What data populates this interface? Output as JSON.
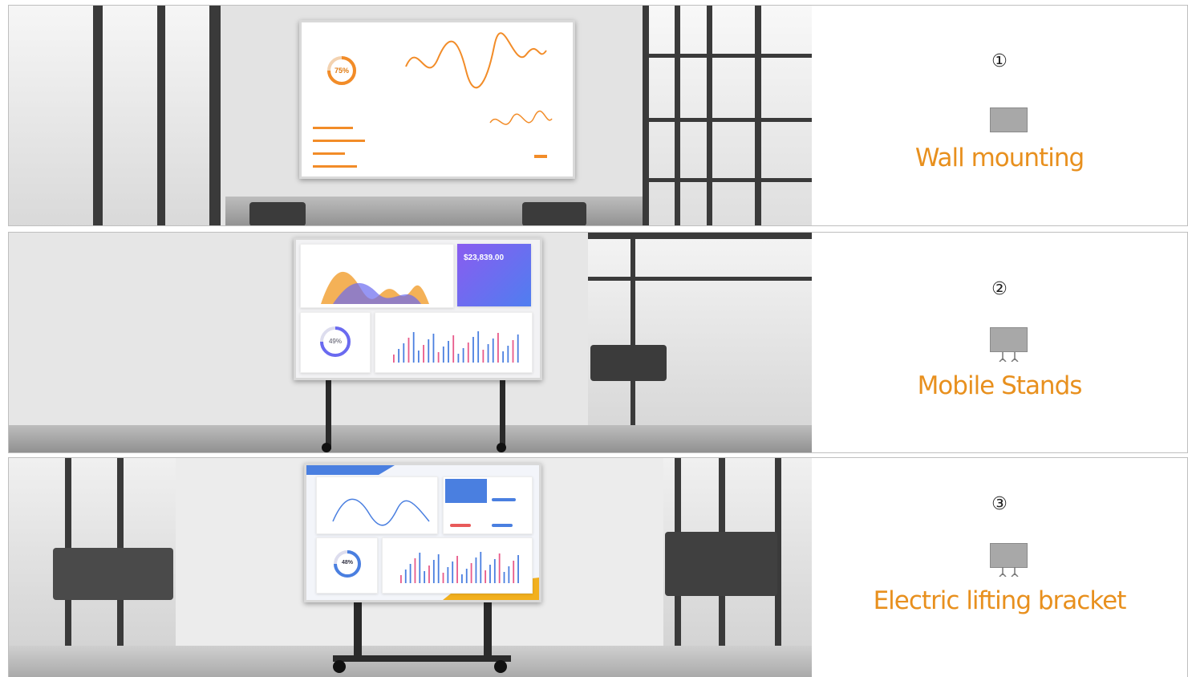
{
  "options": [
    {
      "number": "①",
      "label": "Wall mounting"
    },
    {
      "number": "②",
      "label": "Mobile Stands"
    },
    {
      "number": "③",
      "label": "Electric lifting bracket"
    }
  ],
  "screens": {
    "wall": {
      "gauge": "75%"
    },
    "mobile": {
      "amount": "$23,839.00",
      "gauge": "49%"
    },
    "electric": {
      "gauge": "48%"
    }
  },
  "colors": {
    "label": "#e8901e",
    "accent_orange": "#f28c28",
    "accent_blue": "#4a7fe0",
    "accent_purple": "#7b5cf0"
  }
}
